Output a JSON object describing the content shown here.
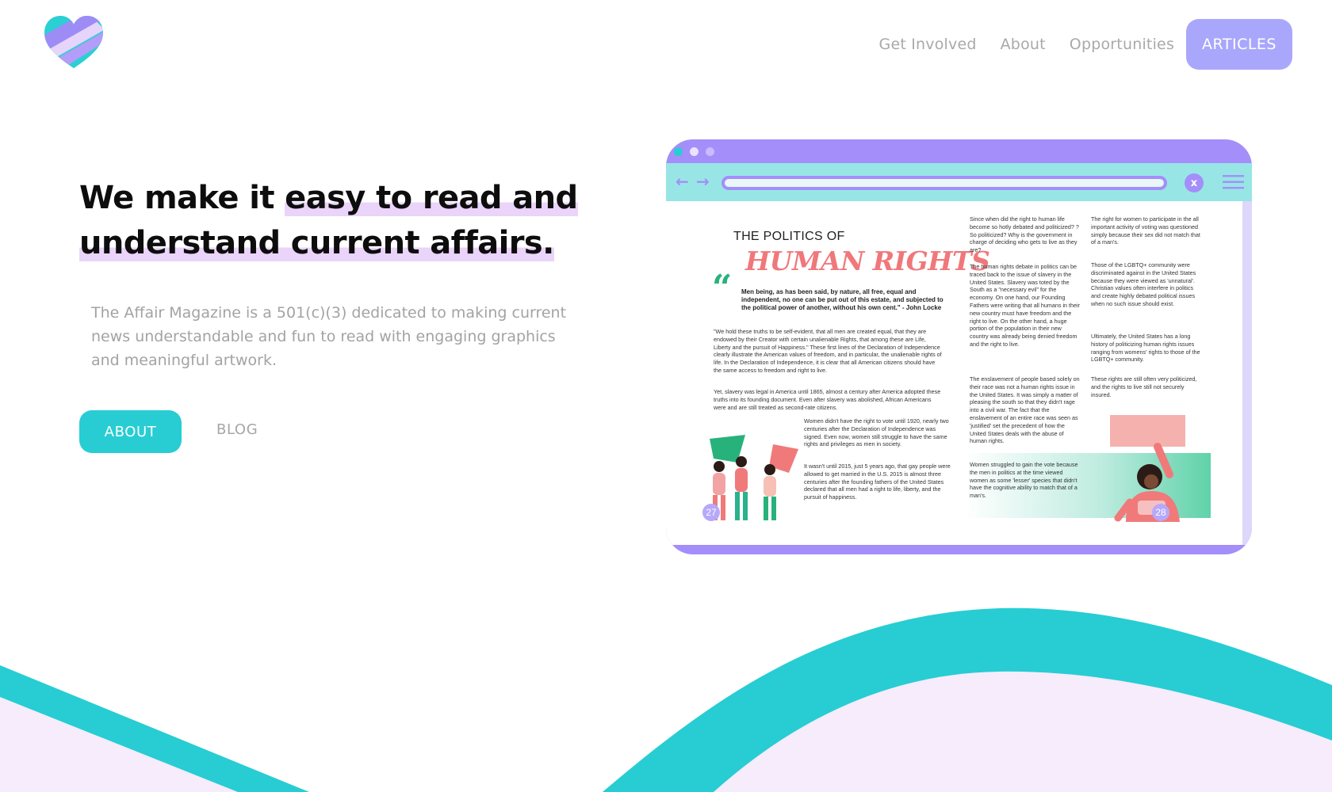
{
  "nav": {
    "links": [
      "Get Involved",
      "About",
      "Opportunities"
    ],
    "cta": "ARTICLES"
  },
  "hero": {
    "headline_plain": "We make it ",
    "headline_highlight_1": "easy to read and",
    "headline_highlight_2": "understand current affairs.",
    "description": "The Affair Magazine is a 501(c)(3) dedicated to making current news understandable and fun to read with engaging graphics and meaningful artwork.",
    "primary_button": "ABOUT",
    "secondary_button": "BLOG"
  },
  "preview": {
    "close_label": "x",
    "kicker": "THE POLITICS OF",
    "title": "HUMAN RIGHTS",
    "quote": "Men being, as has been said, by nature, all free, equal and independent, no one can be put out of this estate, and subjected to the political power of another, without his own cent.\" - John Locke",
    "para_1": "\"We hold these truths to be self-evident, that all men are created equal, that they are endowed by their Creator with certain unalienable Rights, that among these are Life, Liberty and the pursuit of Happiness.\" These first lines of the Declaration of Independence clearly illustrate the American values of freedom, and in particular, the unalienable rights of life. In the Declaration of Independence, it is clear that all American citizens should have the same access to freedom and right to live.",
    "para_2": "Yet, slavery was legal in America until 1865, almost a century after America adopted these truths into its founding document. Even after slavery was abolished, African Americans were and are still treated as second-rate citizens.",
    "para_3": "Women didn't have the right to vote until 1920, nearly two centuries after the Declaration of Independence was signed. Even now, women still struggle to have the same rights and privileges as men in society.",
    "para_4": "It wasn't until 2015, just 5 years ago, that gay people were allowed to get married in the U.S. 2015 is almost three centuries after the founding fathers of the United States declared that all men had a right to life, liberty, and the pursuit of happiness.",
    "col2_1": "Since when did the right to human life become so hotly debated and politicized? ? So politicized? Why is the government in charge of deciding who gets to live as they are?",
    "col2_2": "The human rights debate in politics can be traced back to the issue of slavery in the United States. Slavery was toted by the South as a \"necessary evil\" for the economy. On one hand, our Founding Fathers were writing that all humans in their new country must have freedom and the right to live. On the other hand, a huge portion of the population in their new country was already being denied freedom and the right to live.",
    "col2_3": "The enslavement of people based solely on their race was not a human rights issue in the United States. It was simply a matter of pleasing the south so that they didn't rage into a civil war. The fact that the enslavement of an entire race was seen as 'justified' set the precedent of how the United States deals with the abuse of human rights.",
    "col2_4": "Women struggled to gain the vote because the men in politics at the time viewed women as some 'lesser' species that didn't have the cognitive ability to match that of a man's.",
    "col3_1": "The right for women to participate in the all important activity of voting was questioned simply because their sex did not match that of a man's.",
    "col3_2": "Those of the LGBTQ+ community were discriminated against in the United States because they were viewed as 'unnatural'. Christian values often interfere in politics and create highly debated political issues when no such issue should exist.",
    "col3_3": "Ultimately, the United States has a long history of politicizing human rights issues ranging from womens' rights to those of the LGBTQ+ community.",
    "col3_4": "These rights are still often very politicized, and the rights to live still not securely insured.",
    "page_left": "27",
    "page_right": "28"
  },
  "colors": {
    "accent_teal": "#27cdd3",
    "accent_purple": "#a48ef9",
    "highlight": "#ead4fa",
    "wave_light": "#f6ecfc"
  }
}
